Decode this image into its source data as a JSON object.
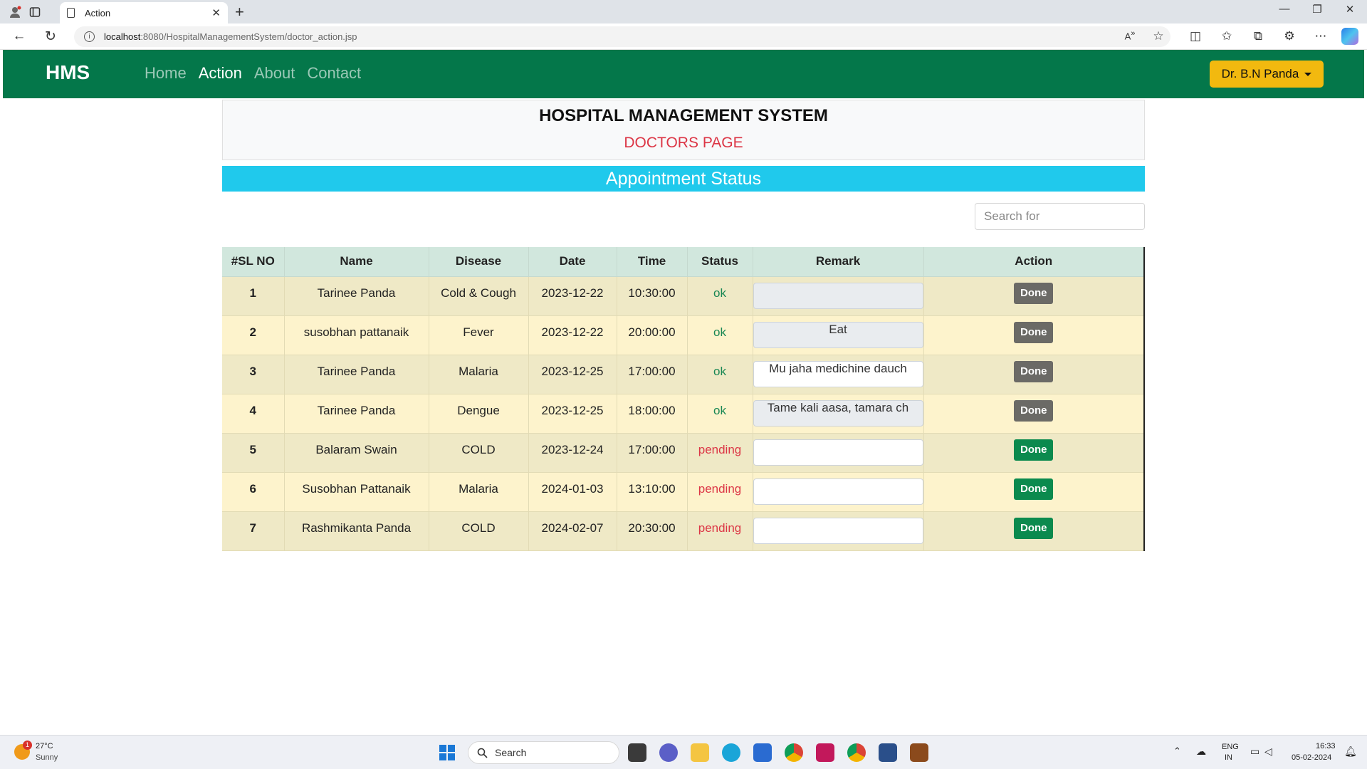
{
  "browser": {
    "tab_title": "Action",
    "url_host": "localhost",
    "url_path": ":8080/HospitalManagementSystem/doctor_action.jsp"
  },
  "navbar": {
    "brand": "HMS",
    "links": [
      "Home",
      "Action",
      "About",
      "Contact"
    ],
    "active_link": "Action",
    "user_menu": "Dr. B.N Panda"
  },
  "header": {
    "title": "HOSPITAL MANAGEMENT SYSTEM",
    "subtitle": "DOCTORS PAGE"
  },
  "section_title": "Appointment Status",
  "search": {
    "placeholder": "Search for"
  },
  "table": {
    "columns": [
      "#SL NO",
      "Name",
      "Disease",
      "Date",
      "Time",
      "Status",
      "Remark",
      "Action"
    ],
    "rows": [
      {
        "sl": "1",
        "name": "Tarinee Panda",
        "disease": "Cold & Cough",
        "date": "2023-12-22",
        "time": "10:30:00",
        "status": "ok",
        "remark": "",
        "action": "Done"
      },
      {
        "sl": "2",
        "name": "susobhan pattanaik",
        "disease": "Fever",
        "date": "2023-12-22",
        "time": "20:00:00",
        "status": "ok",
        "remark": "Eat",
        "action": "Done"
      },
      {
        "sl": "3",
        "name": "Tarinee Panda",
        "disease": "Malaria",
        "date": "2023-12-25",
        "time": "17:00:00",
        "status": "ok",
        "remark": "Mu jaha medichine dauch",
        "action": "Done"
      },
      {
        "sl": "4",
        "name": "Tarinee Panda",
        "disease": "Dengue",
        "date": "2023-12-25",
        "time": "18:00:00",
        "status": "ok",
        "remark": "Tame kali aasa, tamara ch",
        "action": "Done"
      },
      {
        "sl": "5",
        "name": "Balaram Swain",
        "disease": "COLD",
        "date": "2023-12-24",
        "time": "17:00:00",
        "status": "pending",
        "remark": "",
        "action": "Done"
      },
      {
        "sl": "6",
        "name": "Susobhan Pattanaik",
        "disease": "Malaria",
        "date": "2024-01-03",
        "time": "13:10:00",
        "status": "pending",
        "remark": "",
        "action": "Done"
      },
      {
        "sl": "7",
        "name": "Rashmikanta Panda",
        "disease": "COLD",
        "date": "2024-02-07",
        "time": "20:30:00",
        "status": "pending",
        "remark": "",
        "action": "Done"
      }
    ]
  },
  "taskbar": {
    "weather_temp": "27°C",
    "weather_condition": "Sunny",
    "weather_badge": "1",
    "search_label": "Search",
    "lang_top": "ENG",
    "lang_bottom": "IN",
    "time": "16:33",
    "date": "05-02-2024"
  },
  "colors": {
    "navbar": "#04774a",
    "accent_bar": "#20c9ec",
    "user_button": "#f2b90f",
    "status_ok": "#198754",
    "status_pending": "#dc3545",
    "done_ok": "#6b6a66",
    "done_pending": "#0b8a4e"
  },
  "icons": [
    "profile-icon",
    "tab-actions-icon",
    "page-icon",
    "close-icon",
    "plus-icon",
    "minimize-icon",
    "restore-icon",
    "back-icon",
    "refresh-icon",
    "info-icon",
    "read-aloud-icon",
    "favorite-icon",
    "split-screen-icon",
    "favorites-icon",
    "collections-icon",
    "extensions-icon",
    "more-icon",
    "copilot-icon",
    "weather-icon",
    "windows-start-icon",
    "search-icon"
  ]
}
